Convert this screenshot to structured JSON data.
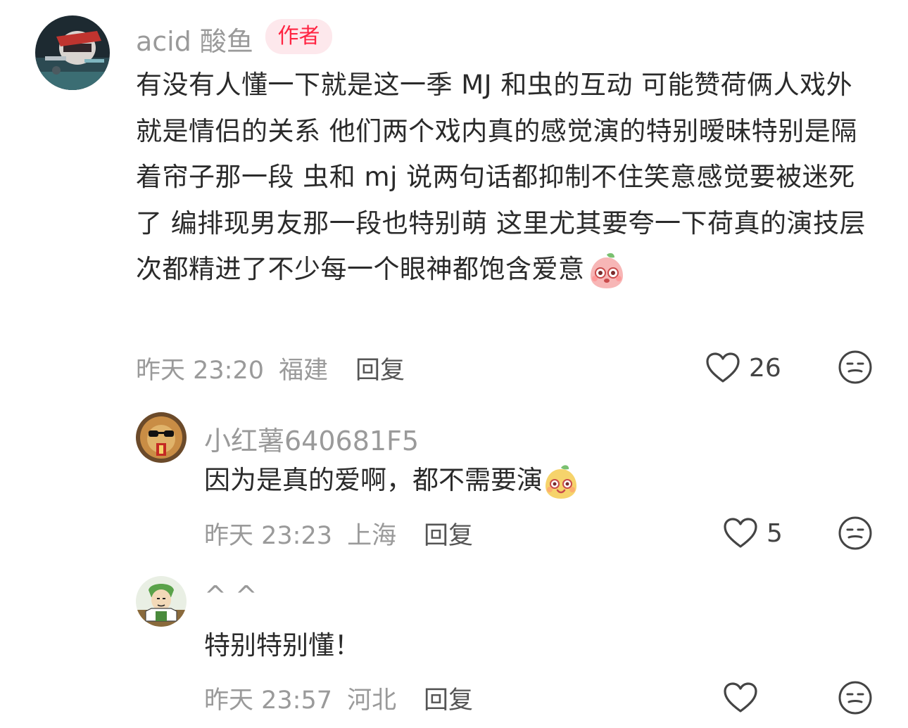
{
  "comments": [
    {
      "username": "acid 酸鱼",
      "badge": "作者",
      "text": "有没有人懂一下就是这一季 MJ 和虫的互动 可能赞荷俩人戏外就是情侣的关系 他们两个戏内真的感觉演的特别暧昧特别是隔着帘子那一段 虫和 mj 说两句话都抑制不住笑意感觉要被迷死了 编排现男友那一段也特别萌 这里尤其要夸一下荷真的演技层次都精进了不少每一个眼神都饱含爱意",
      "emoji": "peach-shy-emoji",
      "time": "昨天 23:20",
      "location": "福建",
      "reply_label": "回复",
      "likes": "26",
      "avatar_icon": "racing-driver-avatar"
    }
  ],
  "replies": [
    {
      "username": "小红薯640681F5",
      "text": "因为是真的爱啊，都不需要演",
      "emoji": "mango-happy-emoji",
      "time": "昨天 23:23",
      "location": "上海",
      "reply_label": "回复",
      "likes": "5",
      "avatar_icon": "lion-sunglasses-avatar"
    },
    {
      "username": "^ ^",
      "text": "特别特别懂！",
      "time": "昨天 23:57",
      "location": "河北",
      "reply_label": "回复",
      "likes": "",
      "avatar_icon": "anime-character-avatar"
    }
  ],
  "icons": {
    "like": "heart-outline-icon",
    "dislike": "neutral-face-icon"
  },
  "colors": {
    "badge_bg": "#fde8ec",
    "badge_text": "#ff2442",
    "meta_text": "#9a9a9a",
    "body_text": "#2a2a2a"
  }
}
